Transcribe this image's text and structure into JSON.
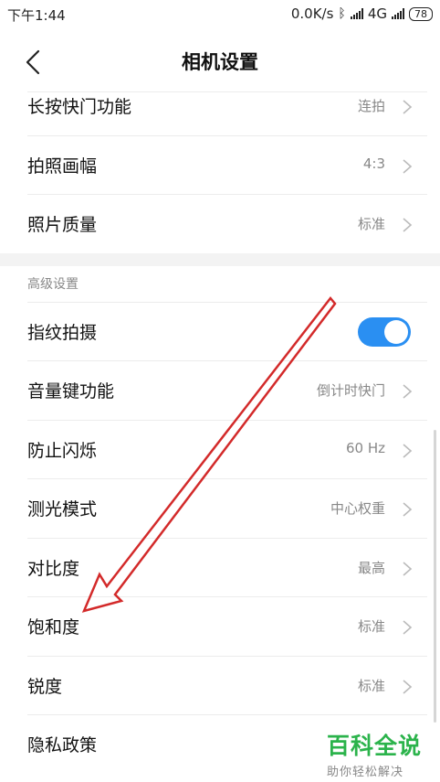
{
  "status_bar": {
    "time": "下午1:44",
    "speed": "0.0K/s",
    "network": "4G",
    "battery": "78"
  },
  "header": {
    "title": "相机设置",
    "back_icon": "chevron-left-icon"
  },
  "settings": {
    "rows_top": [
      {
        "label": "长按快门功能",
        "value": "连拍"
      },
      {
        "label": "拍照画幅",
        "value": "4:3"
      },
      {
        "label": "照片质量",
        "value": "标准"
      }
    ],
    "advanced_section_title": "高级设置",
    "fingerprint": {
      "label": "指纹拍摄",
      "enabled": true,
      "toggle_color": "#2a8ff2"
    },
    "rows_advanced": [
      {
        "label": "音量键功能",
        "value": "倒计时快门"
      },
      {
        "label": "防止闪烁",
        "value": "60 Hz"
      },
      {
        "label": "测光模式",
        "value": "中心权重"
      },
      {
        "label": "对比度",
        "value": "最高"
      },
      {
        "label": "饱和度",
        "value": "标准"
      },
      {
        "label": "锐度",
        "value": "标准"
      },
      {
        "label": "隐私政策",
        "value": ""
      }
    ]
  },
  "annotation": {
    "arrow_color": "#d32a2a"
  },
  "watermark": {
    "main": "百科全说",
    "sub": "助你轻松解决",
    "color": "#2bb34b"
  }
}
